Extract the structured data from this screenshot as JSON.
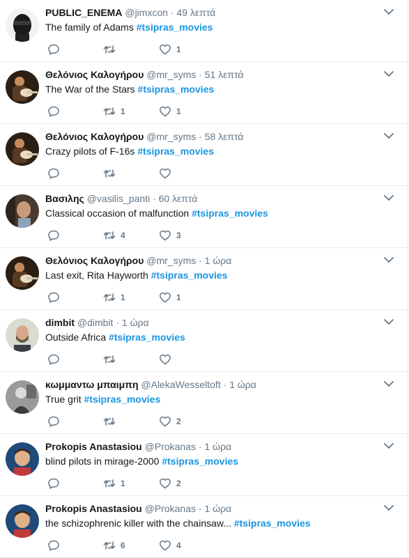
{
  "colors": {
    "hashtag": "#1b95e0",
    "muted": "#657786",
    "text": "#14171a",
    "divider": "#e6ecf0"
  },
  "tweets": [
    {
      "name": "PUBLIC_ENEMA",
      "handle": "@jimxcon",
      "dot": "·",
      "time": "49 λεπτά",
      "text": "The family of Adams ",
      "hashtag": "#tsipras_movies",
      "replies": "",
      "retweets": "",
      "likes": "1",
      "avatar": "masked-avatar"
    },
    {
      "name": "Θελόνιος Καλογήρου",
      "handle": "@mr_syms",
      "dot": "·",
      "time": "51 λεπτά",
      "text": "The War of the Stars ",
      "hashtag": "#tsipras_movies",
      "replies": "",
      "retweets": "1",
      "likes": "1",
      "avatar": "guitarist-avatar"
    },
    {
      "name": "Θελόνιος Καλογήρου",
      "handle": "@mr_syms",
      "dot": "·",
      "time": "58 λεπτά",
      "text": "Crazy pilots of F-16s ",
      "hashtag": "#tsipras_movies",
      "replies": "",
      "retweets": "",
      "likes": "",
      "avatar": "guitarist-avatar"
    },
    {
      "name": "Βασιλης",
      "handle": "@vasilis_panti",
      "dot": "·",
      "time": "60 λεπτά",
      "text": "Classical occasion of malfunction ",
      "hashtag": "#tsipras_movies",
      "replies": "",
      "retweets": "4",
      "likes": "3",
      "avatar": "profile-avatar"
    },
    {
      "name": "Θελόνιος Καλογήρου",
      "handle": "@mr_syms",
      "dot": "·",
      "time": "1 ώρα",
      "text": "Last exit, Rita Hayworth  ",
      "hashtag": "#tsipras_movies",
      "replies": "",
      "retweets": "1",
      "likes": "1",
      "avatar": "guitarist-avatar"
    },
    {
      "name": "dimbit",
      "handle": "@dimbit",
      "dot": "·",
      "time": "1 ώρα",
      "text": "Outside Africa ",
      "hashtag": "#tsipras_movies",
      "replies": "",
      "retweets": "",
      "likes": "",
      "avatar": "bearded-avatar"
    },
    {
      "name": "κωμμαντω μπαιμπη",
      "handle": "@AlekaWesseltoft",
      "dot": "·",
      "time": "1 ώρα",
      "text": "True grit ",
      "hashtag": "#tsipras_movies",
      "replies": "",
      "retweets": "",
      "likes": "2",
      "avatar": "bw-avatar"
    },
    {
      "name": "Prokopis Anastasiou",
      "handle": "@Prokanas",
      "dot": "·",
      "time": "1 ώρα",
      "text": "blind pilots in mirage-2000 ",
      "hashtag": "#tsipras_movies",
      "replies": "",
      "retweets": "1",
      "likes": "2",
      "avatar": "cartoon-avatar"
    },
    {
      "name": "Prokopis Anastasiou",
      "handle": "@Prokanas",
      "dot": "·",
      "time": "1 ώρα",
      "text": "the schizophrenic killer with the chainsaw... ",
      "hashtag": "#tsipras_movies",
      "replies": "",
      "retweets": "6",
      "likes": "4",
      "avatar": "cartoon-avatar"
    }
  ]
}
